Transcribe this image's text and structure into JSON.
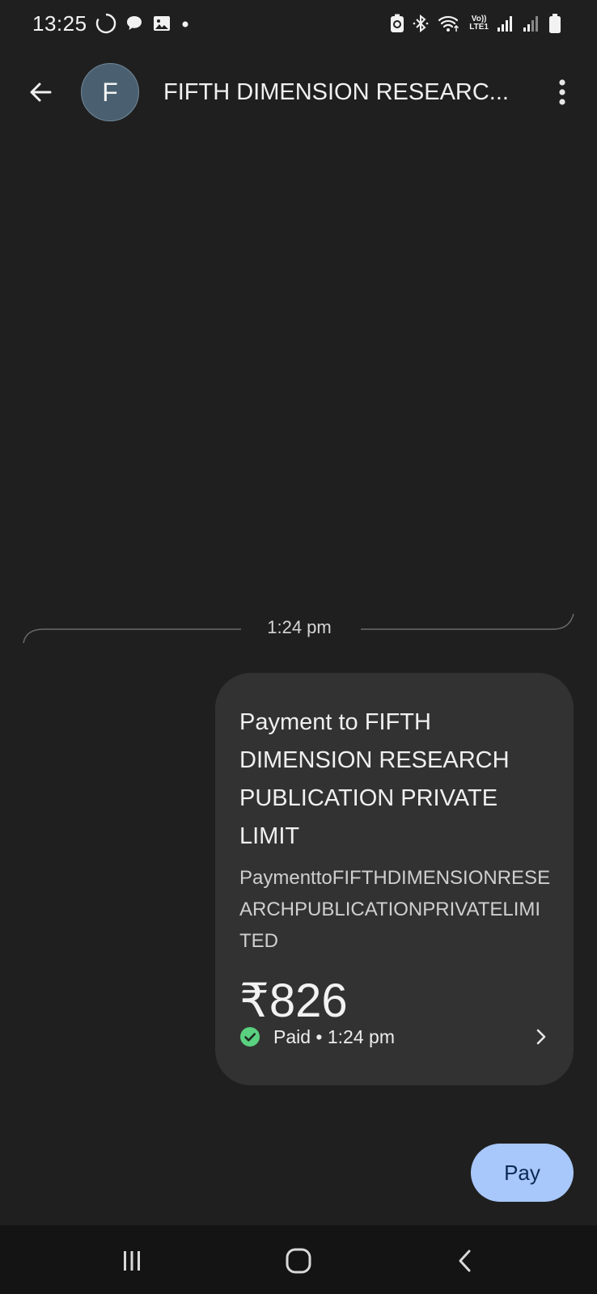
{
  "status_bar": {
    "time": "13:25",
    "left_icons": [
      "sync-circle-icon",
      "chat-bubble-icon",
      "image-icon",
      "dot-icon"
    ],
    "right_icons": [
      "battery-saver-icon",
      "bluetooth-icon",
      "wifi-icon",
      "volte-icon",
      "signal-icon",
      "signal-icon",
      "battery-icon"
    ],
    "volte_line1": "Vo))",
    "volte_line2": "LTE1"
  },
  "header": {
    "avatar_letter": "F",
    "title": "FIFTH DIMENSION RESEARC...",
    "back_icon": "arrow-left-icon",
    "more_icon": "more-vertical-icon"
  },
  "conversation": {
    "timestamp": "1:24 pm"
  },
  "payment": {
    "title": "Payment to FIFTH DIMENSION RESEARCH PUBLICATION PRIVATE LIMIT",
    "note": "PaymenttoFIFTHDIMENSIONRESEARCHPUBLICATIONPRIVATELIMITED",
    "amount": "₹826",
    "status": "Paid • 1:24 pm",
    "status_icon": "check-circle-icon",
    "chevron_icon": "chevron-right-icon"
  },
  "actions": {
    "pay_label": "Pay"
  },
  "colors": {
    "background": "#1f1f1f",
    "card": "#323232",
    "pay_button": "#a8c7fa",
    "pay_text": "#0b2a55",
    "paid_check": "#5ad17f",
    "avatar": "#4a6070"
  },
  "nav_bar": {
    "icons": [
      "recents-icon",
      "home-icon",
      "back-icon"
    ]
  }
}
